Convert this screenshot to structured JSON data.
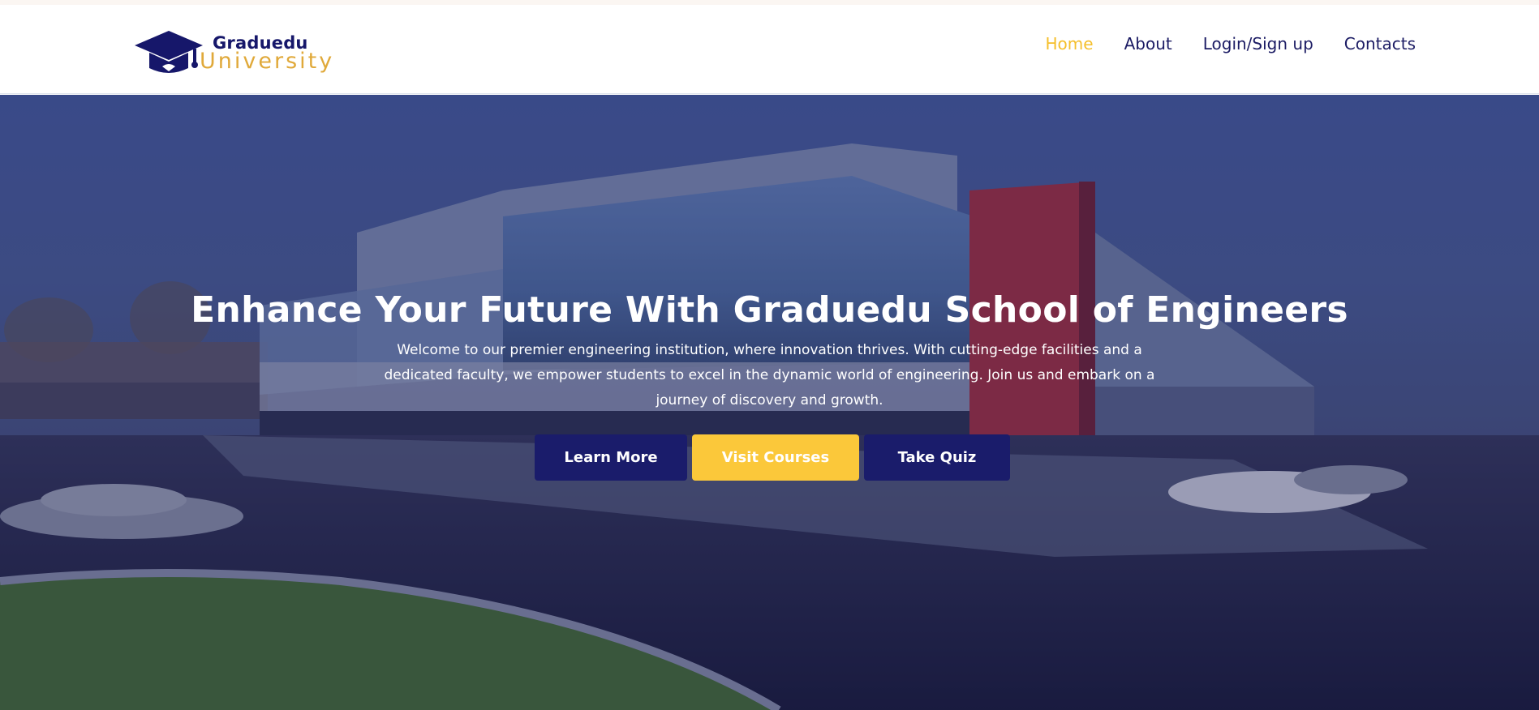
{
  "brand": {
    "name": "Graduedu",
    "subtitle": "University",
    "colors": {
      "navy": "#16176a",
      "gold": "#e0a93a"
    }
  },
  "nav": {
    "items": [
      {
        "label": "Home",
        "active": true
      },
      {
        "label": "About",
        "active": false
      },
      {
        "label": "Login/Sign up",
        "active": false
      },
      {
        "label": "Contacts",
        "active": false
      }
    ],
    "colors": {
      "text": "#1c1c64",
      "active": "#f5bf2b"
    }
  },
  "hero": {
    "title": "Enhance Your Future With Graduedu School of Engineers",
    "description": "Welcome to our premier engineering institution, where innovation thrives. With cutting-edge facilities and a dedicated faculty, we empower students to excel in the dynamic world of engineering. Join us and embark on a journey of discovery and growth.",
    "buttons": {
      "learn_more": "Learn More",
      "visit_courses": "Visit Courses",
      "take_quiz": "Take Quiz"
    },
    "colors": {
      "button_dark": "#1a1c6b",
      "button_yellow": "#fbc83a"
    }
  }
}
